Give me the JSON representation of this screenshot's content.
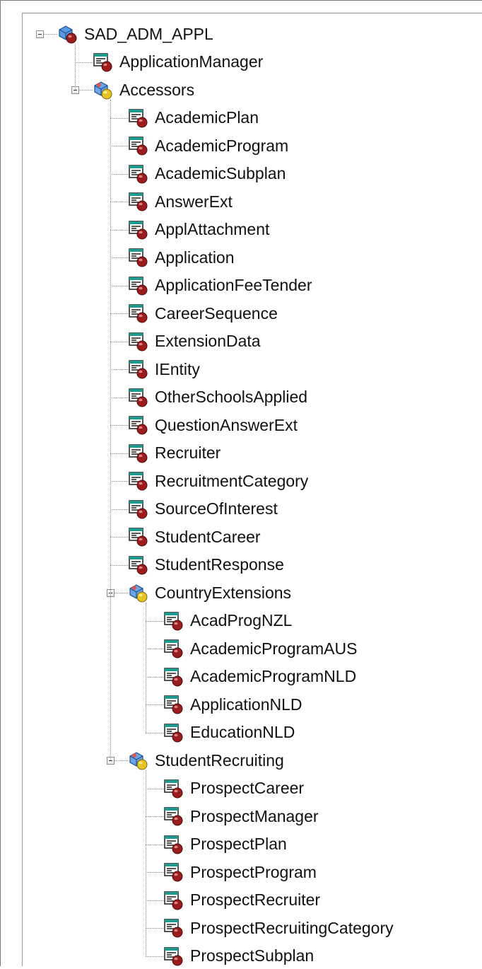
{
  "tree": {
    "root": {
      "label": "SAD_ADM_APPL",
      "icon": "package-icon",
      "expanded": true,
      "children": [
        {
          "label": "ApplicationManager",
          "icon": "class-icon"
        },
        {
          "label": "Accessors",
          "icon": "subpackage-icon",
          "expanded": true,
          "children": [
            {
              "label": "AcademicPlan",
              "icon": "class-icon"
            },
            {
              "label": "AcademicProgram",
              "icon": "class-icon"
            },
            {
              "label": "AcademicSubplan",
              "icon": "class-icon"
            },
            {
              "label": "AnswerExt",
              "icon": "class-icon"
            },
            {
              "label": "ApplAttachment",
              "icon": "class-icon"
            },
            {
              "label": "Application",
              "icon": "class-icon"
            },
            {
              "label": "ApplicationFeeTender",
              "icon": "class-icon"
            },
            {
              "label": "CareerSequence",
              "icon": "class-icon"
            },
            {
              "label": "ExtensionData",
              "icon": "class-icon"
            },
            {
              "label": "IEntity",
              "icon": "class-icon"
            },
            {
              "label": "OtherSchoolsApplied",
              "icon": "class-icon"
            },
            {
              "label": "QuestionAnswerExt",
              "icon": "class-icon"
            },
            {
              "label": "Recruiter",
              "icon": "class-icon"
            },
            {
              "label": "RecruitmentCategory",
              "icon": "class-icon"
            },
            {
              "label": "SourceOfInterest",
              "icon": "class-icon"
            },
            {
              "label": "StudentCareer",
              "icon": "class-icon"
            },
            {
              "label": "StudentResponse",
              "icon": "class-icon"
            },
            {
              "label": "CountryExtensions",
              "icon": "subpackage-icon",
              "expanded": true,
              "children": [
                {
                  "label": "AcadProgNZL",
                  "icon": "class-icon"
                },
                {
                  "label": "AcademicProgramAUS",
                  "icon": "class-icon"
                },
                {
                  "label": "AcademicProgramNLD",
                  "icon": "class-icon"
                },
                {
                  "label": "ApplicationNLD",
                  "icon": "class-icon"
                },
                {
                  "label": "EducationNLD",
                  "icon": "class-icon"
                }
              ]
            },
            {
              "label": "StudentRecruiting",
              "icon": "subpackage-icon",
              "expanded": true,
              "children": [
                {
                  "label": "ProspectCareer",
                  "icon": "class-icon"
                },
                {
                  "label": "ProspectManager",
                  "icon": "class-icon"
                },
                {
                  "label": "ProspectPlan",
                  "icon": "class-icon"
                },
                {
                  "label": "ProspectProgram",
                  "icon": "class-icon"
                },
                {
                  "label": "ProspectRecruiter",
                  "icon": "class-icon"
                },
                {
                  "label": "ProspectRecruitingCategory",
                  "icon": "class-icon"
                },
                {
                  "label": "ProspectSubplan",
                  "icon": "class-icon"
                }
              ]
            }
          ]
        }
      ]
    }
  }
}
